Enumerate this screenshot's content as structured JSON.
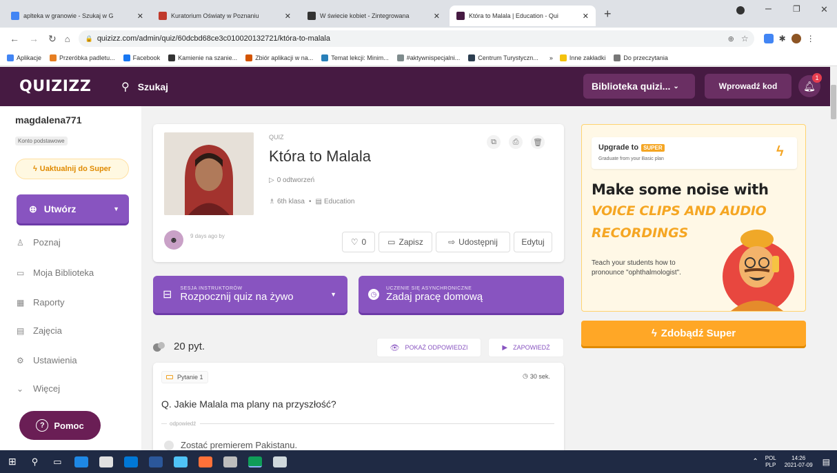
{
  "browser": {
    "tabs": [
      {
        "title": "aplteka w granowie - Szukaj w G",
        "color": "#4285f4"
      },
      {
        "title": "Kuratorium Oświaty w Poznaniu",
        "color": "#c0392b"
      },
      {
        "title": "W świecie kobiet - Zintegrowana",
        "color": "#333333"
      },
      {
        "title": "Która to Malala | Education - Qui",
        "color": "#461a42",
        "active": true
      }
    ],
    "new_tab": "+",
    "url": "quizizz.com/admin/quiz/60dcbd68ce3c010020132721/która-to-malala",
    "bookmarks": [
      {
        "label": "Aplikacje",
        "color": "#4285f4"
      },
      {
        "label": "Przeróbka padletu...",
        "color": "#e67e22"
      },
      {
        "label": "Facebook",
        "color": "#1877f2"
      },
      {
        "label": "Kamienie na szanie...",
        "color": "#333333"
      },
      {
        "label": "Zbiór aplikacji w na...",
        "color": "#d35400"
      },
      {
        "label": "Temat lekcji: Minim...",
        "color": "#2980b9"
      },
      {
        "label": "#aktywnispecjalni...",
        "color": "#7f8c8d"
      },
      {
        "label": "Centrum Turystyczn...",
        "color": "#2c3e50"
      }
    ],
    "bookmarks_more": "»",
    "other_bookmarks": "Inne zakładki",
    "reading_list": "Do przeczytania"
  },
  "header": {
    "logo": "QUIZIZZ",
    "search_label": "Szukaj",
    "library_label": "Biblioteka quizi...",
    "enter_code": "Wprowadź kod",
    "notifications_count": "1"
  },
  "sidebar": {
    "username": "magdalena771",
    "account_type": "Konto podstawowe",
    "upgrade_label": "Uaktualnij do Super",
    "create_label": "Utwórz",
    "nav": [
      {
        "label": "Poznaj",
        "icon": "explore-icon"
      },
      {
        "label": "Moja Biblioteka",
        "icon": "folder-icon"
      },
      {
        "label": "Raporty",
        "icon": "reports-icon"
      },
      {
        "label": "Zajęcia",
        "icon": "classes-icon"
      },
      {
        "label": "Ustawienia",
        "icon": "settings-icon"
      },
      {
        "label": "Więcej",
        "icon": "chevron-down-icon"
      }
    ],
    "help_label": "Pomoc"
  },
  "quiz": {
    "type_label": "QUIZ",
    "title": "Która to Malala",
    "plays": "0 odtworzeń",
    "grade": "6th klasa",
    "subject": "Education",
    "created": "9 days ago by",
    "likes": "0",
    "save_label": "Zapisz",
    "share_label": "Udostępnij",
    "edit_label": "Edytuj"
  },
  "actions": {
    "live_sub": "SESJA INSTRUKTORÓW",
    "live_main": "Rozpocznij quiz na żywo",
    "homework_sub": "UCZENIE SIĘ ASYNCHRONICZNE",
    "homework_main": "Zadaj pracę domową"
  },
  "questions": {
    "count": "20 pyt.",
    "show_answers": "POKAŻ ODPOWIEDZI",
    "preview": "ZAPOWIEDŹ",
    "first": {
      "label": "Pytanie 1",
      "time": "30 sek.",
      "text": "Q. Jakie Malala ma plany na przyszłość?",
      "answers_label": "odpowiedź",
      "answer_1": "Zostać premierem Pakistanu."
    }
  },
  "promo": {
    "upgrade_to": "Upgrade to",
    "super_badge": "SUPER",
    "graduate": "Graduate from your Basic plan",
    "headline_1": "Make some noise with",
    "headline_2": "VOICE CLIPS AND AUDIO",
    "headline_3": "RECORDINGS",
    "body": "Teach your students how to pronounce \"ophthalmologist\".",
    "cta": "Zdobądź Super"
  },
  "taskbar": {
    "lang": "POL",
    "lang2": "PLP",
    "time": "14:26",
    "date": "2021-07-09"
  },
  "colors": {
    "brand": "#461a42",
    "purple": "#8854c0",
    "orange": "#ffa726"
  }
}
